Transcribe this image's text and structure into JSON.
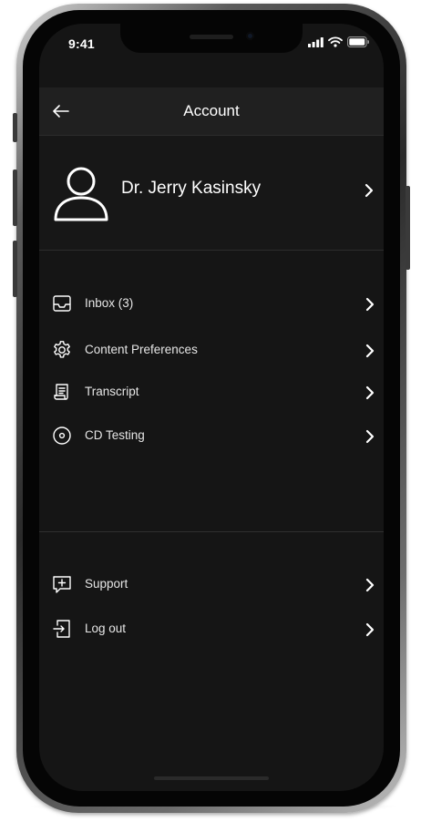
{
  "status_bar": {
    "time": "9:41"
  },
  "header": {
    "title": "Account",
    "back_icon": "arrow-left-icon"
  },
  "profile": {
    "name": "Dr. Jerry Kasinsky",
    "icon": "user-avatar-icon"
  },
  "menu_main": [
    {
      "label": "Inbox (3)",
      "icon": "inbox-tray-icon"
    },
    {
      "label": "Content Preferences",
      "icon": "gear-icon"
    },
    {
      "label": "Transcript",
      "icon": "document-icon"
    },
    {
      "label": "CD Testing",
      "icon": "disc-icon"
    }
  ],
  "menu_secondary": [
    {
      "label": "Support",
      "icon": "chat-plus-icon"
    },
    {
      "label": "Log out",
      "icon": "logout-icon"
    }
  ],
  "colors": {
    "screen_background": "#151515",
    "header_background": "#202020",
    "text_primary": "#ffffff",
    "text_secondary": "#e6e6e6",
    "divider": "#2f2f2f"
  }
}
